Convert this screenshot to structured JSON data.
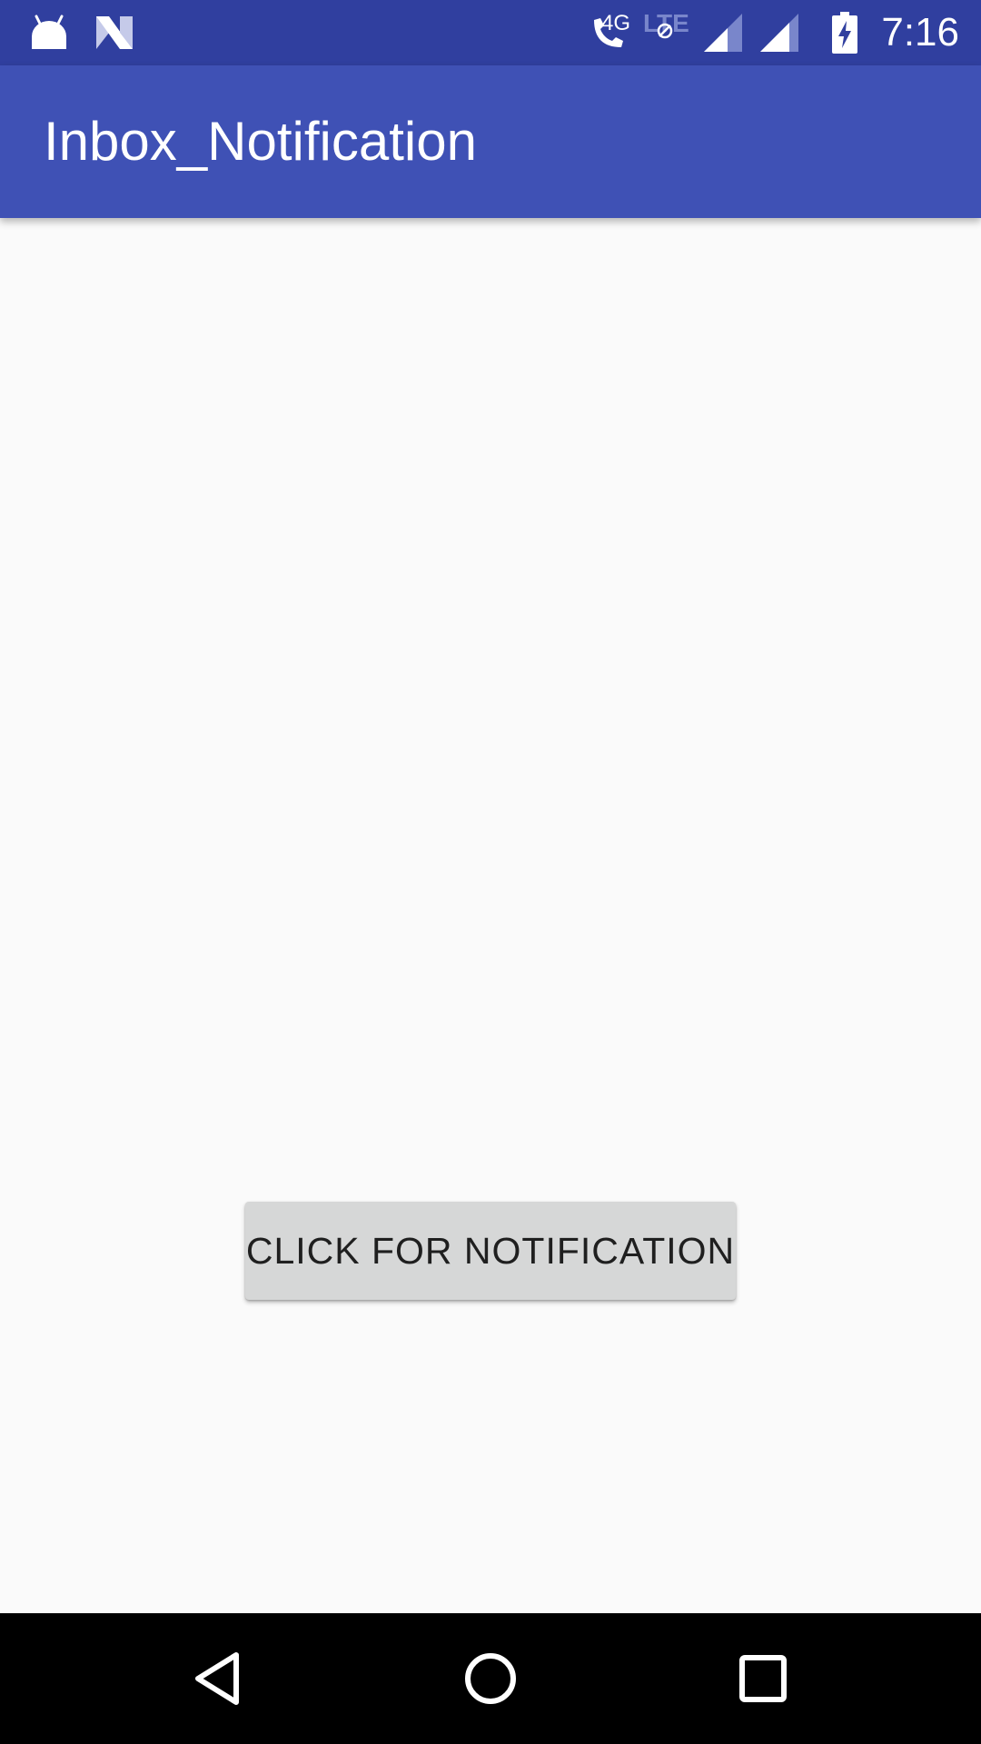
{
  "status_bar": {
    "time": "7:16",
    "network_label": "4G",
    "lte_label": "LTE",
    "icons": [
      "android-icon",
      "n-icon",
      "wifi-call-icon",
      "lte-icon",
      "signal-icon",
      "signal-icon",
      "battery-charging-icon"
    ],
    "background_color": "#303f9f"
  },
  "app_bar": {
    "title": "Inbox_Notification",
    "background_color": "#3f51b5"
  },
  "main": {
    "button_label": "CLICK FOR NOTIFICATION"
  },
  "nav_bar": {
    "icons": [
      "back-icon",
      "home-icon",
      "recents-icon"
    ]
  }
}
